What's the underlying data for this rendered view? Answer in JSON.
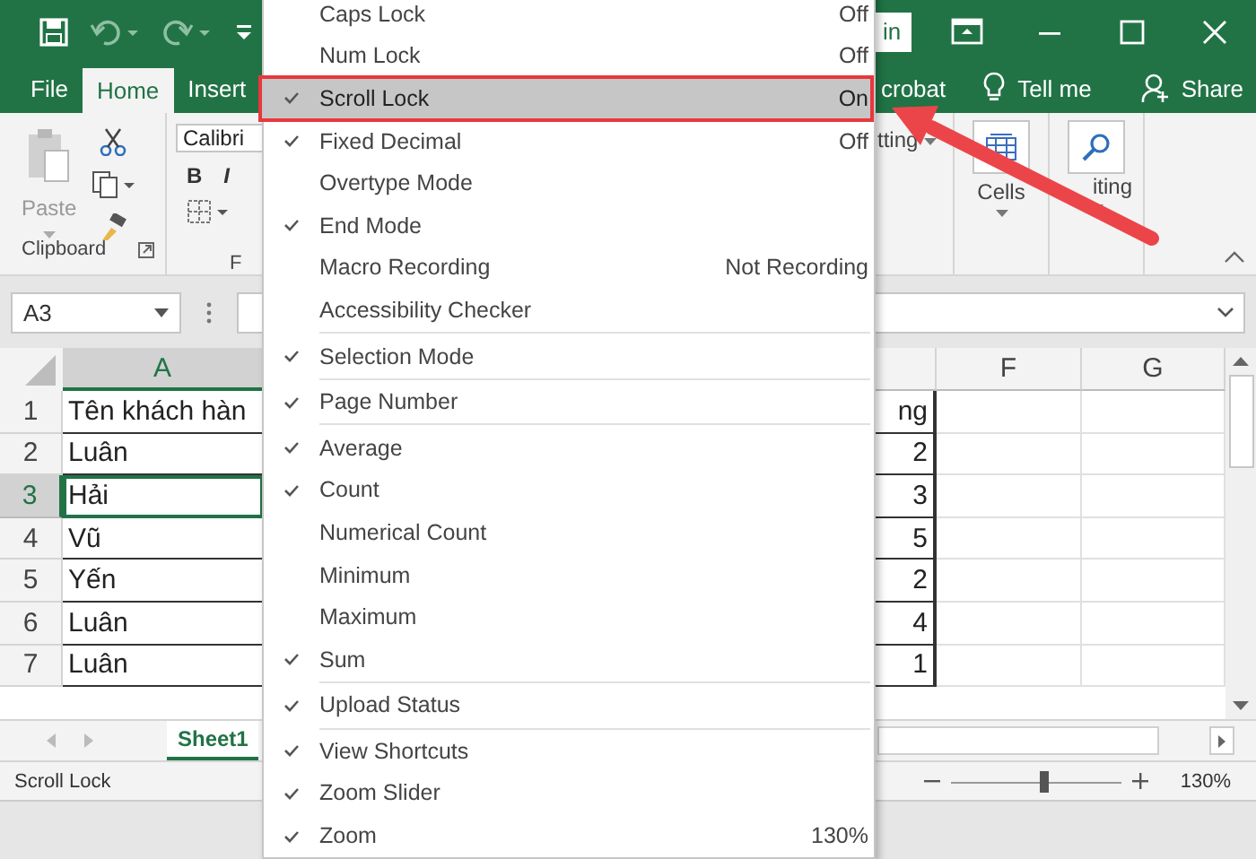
{
  "title_bar": {
    "sign_in": "in"
  },
  "ribbon_tabs": [
    {
      "label": "File",
      "selected": false
    },
    {
      "label": "Home",
      "selected": true
    },
    {
      "label": "Insert",
      "selected": false
    },
    {
      "label": "crobat",
      "selected": false
    }
  ],
  "tell_me": "Tell me",
  "share": "Share",
  "ribbon": {
    "paste": "Paste",
    "font_name": "Calibri",
    "bold": "B",
    "italic": "I",
    "clipboard_label": "Clipboard",
    "font_label": "F",
    "styles_text": "tting",
    "cells": "Cells",
    "editing": "iting"
  },
  "formula_bar": {
    "name_box": "A3"
  },
  "grid": {
    "columns": [
      {
        "label": "A",
        "selected": true
      },
      {
        "label": "F",
        "selected": false
      },
      {
        "label": "G",
        "selected": false
      }
    ],
    "rows": [
      {
        "number": "1",
        "selected": false,
        "cells": [
          "Tên khách hàn",
          "ng"
        ]
      },
      {
        "number": "2",
        "selected": false,
        "cells": [
          "Luân",
          "2"
        ]
      },
      {
        "number": "3",
        "selected": true,
        "cells": [
          "Hải",
          "3"
        ]
      },
      {
        "number": "4",
        "selected": false,
        "cells": [
          "Vũ",
          "5"
        ]
      },
      {
        "number": "5",
        "selected": false,
        "cells": [
          "Yến",
          "2"
        ]
      },
      {
        "number": "6",
        "selected": false,
        "cells": [
          "Luân",
          "4"
        ]
      },
      {
        "number": "7",
        "selected": false,
        "cells": [
          "Luân",
          "1"
        ]
      }
    ]
  },
  "sheet_tabs": [
    {
      "label": "Sheet1",
      "selected": true
    }
  ],
  "status_bar": {
    "mode": "Scroll Lock",
    "zoom_slider": {
      "level": 0.55
    },
    "zoom": "130%"
  },
  "context_menu": {
    "items": [
      {
        "kind": "item",
        "label": "Caps Lock",
        "value": "Off",
        "checked": false,
        "highlighted": false
      },
      {
        "kind": "item",
        "label": "Num Lock",
        "value": "Off",
        "checked": false,
        "highlighted": false
      },
      {
        "kind": "item",
        "label": "Scroll Lock",
        "value": "On",
        "checked": true,
        "highlighted": true,
        "framed": true
      },
      {
        "kind": "item",
        "label": "Fixed Decimal",
        "value": "Off",
        "checked": true,
        "highlighted": false
      },
      {
        "kind": "item",
        "label": "Overtype Mode",
        "checked": false,
        "highlighted": false
      },
      {
        "kind": "item",
        "label": "End Mode",
        "checked": true,
        "highlighted": false
      },
      {
        "kind": "item",
        "label": "Macro Recording",
        "value": "Not Recording",
        "checked": false,
        "highlighted": false
      },
      {
        "kind": "item",
        "label": "Accessibility Checker",
        "checked": false,
        "highlighted": false
      },
      {
        "kind": "separator"
      },
      {
        "kind": "item",
        "label": "Selection Mode",
        "checked": true,
        "highlighted": false
      },
      {
        "kind": "separator"
      },
      {
        "kind": "item",
        "label": "Page Number",
        "checked": true,
        "highlighted": false
      },
      {
        "kind": "separator"
      },
      {
        "kind": "item",
        "label": "Average",
        "checked": true,
        "highlighted": false
      },
      {
        "kind": "item",
        "label": "Count",
        "checked": true,
        "highlighted": false
      },
      {
        "kind": "item",
        "label": "Numerical Count",
        "checked": false,
        "highlighted": false
      },
      {
        "kind": "item",
        "label": "Minimum",
        "checked": false,
        "highlighted": false
      },
      {
        "kind": "item",
        "label": "Maximum",
        "checked": false,
        "highlighted": false
      },
      {
        "kind": "item",
        "label": "Sum",
        "checked": true,
        "highlighted": false
      },
      {
        "kind": "separator"
      },
      {
        "kind": "item",
        "label": "Upload Status",
        "checked": true,
        "highlighted": false
      },
      {
        "kind": "separator"
      },
      {
        "kind": "item",
        "label": "View Shortcuts",
        "checked": true,
        "highlighted": false
      },
      {
        "kind": "item",
        "label": "Zoom Slider",
        "checked": true,
        "highlighted": false
      },
      {
        "kind": "item",
        "label": "Zoom",
        "value": "130%",
        "checked": true,
        "highlighted": false
      }
    ]
  },
  "annotations": [
    {
      "kind": "arrow"
    }
  ]
}
